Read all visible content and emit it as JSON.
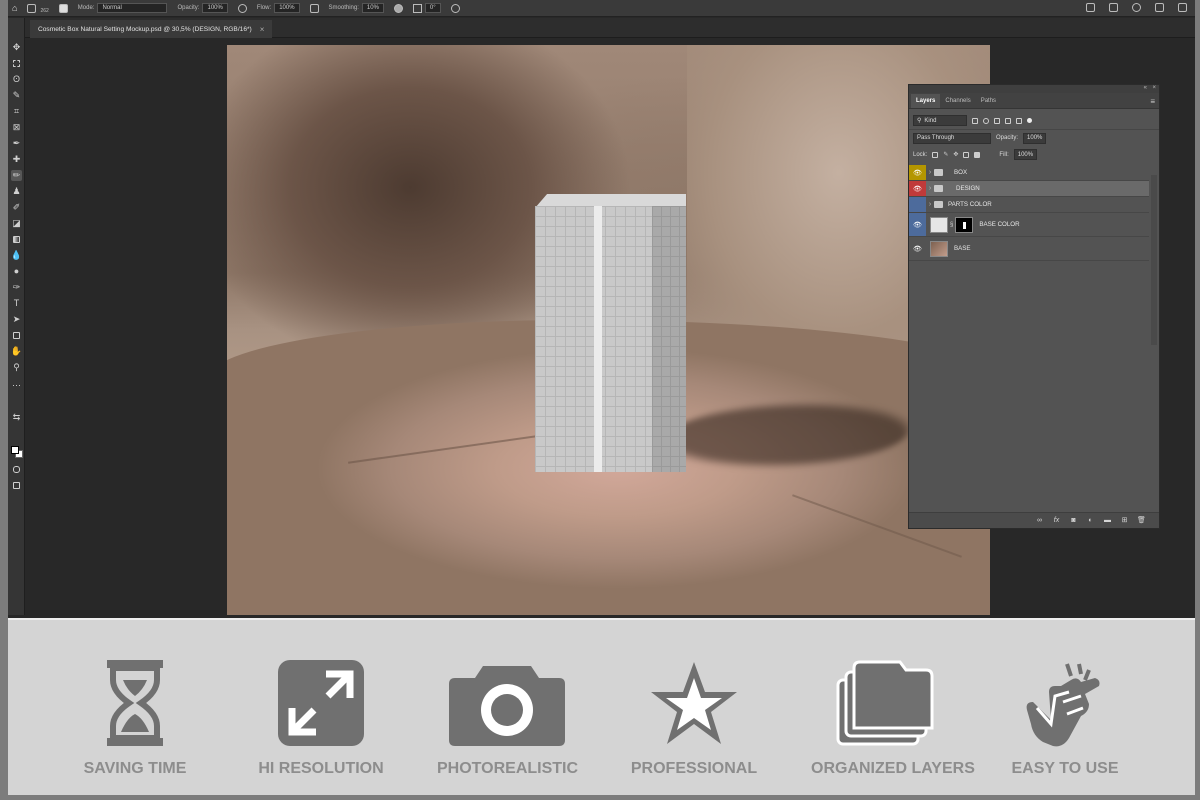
{
  "options_bar": {
    "brush_size": "262",
    "mode_label": "Mode:",
    "mode_value": "Normal",
    "opacity_label": "Opacity:",
    "opacity_value": "100%",
    "flow_label": "Flow:",
    "flow_value": "100%",
    "smoothing_label": "Smoothing:",
    "smoothing_value": "10%",
    "angle_value": "0°"
  },
  "document_tab": {
    "title": "Cosmetic Box Natural Setting Mockup.psd @ 30,5% (DESIGN, RGB/16*)",
    "close": "×"
  },
  "layers_panel": {
    "tabs": [
      "Layers",
      "Channels",
      "Paths"
    ],
    "filter_kind": "Kind",
    "blend_mode": "Pass Through",
    "opacity_label": "Opacity:",
    "opacity_value": "100%",
    "lock_label": "Lock:",
    "fill_label": "Fill:",
    "fill_value": "100%",
    "layers": [
      {
        "name": "BOX",
        "type": "group",
        "eye_color": "#b49600"
      },
      {
        "name": "DESIGN",
        "type": "group",
        "eye_color": "#c03a3a",
        "selected": true
      },
      {
        "name": "PARTS COLOR",
        "type": "group",
        "eye_color": "#4d6b9c",
        "visible": false
      },
      {
        "name": "BASE COLOR",
        "type": "fill",
        "eye_color": "#4d6b9c"
      },
      {
        "name": "BASE",
        "type": "image"
      }
    ]
  },
  "features": [
    {
      "icon": "hourglass-icon",
      "label": "SAVING TIME"
    },
    {
      "icon": "expand-icon",
      "label": "HI RESOLUTION"
    },
    {
      "icon": "camera-icon",
      "label": "PHOTOREALISTIC"
    },
    {
      "icon": "star-icon",
      "label": "PROFESSIONAL"
    },
    {
      "icon": "folders-icon",
      "label": "ORGANIZED LAYERS"
    },
    {
      "icon": "pointer-hand-icon",
      "label": "EASY TO USE"
    }
  ],
  "colors": {
    "feature_icon": "#707070",
    "feature_label": "#8d8d8d",
    "feature_bg": "#d4d4d4",
    "panel_bg": "#535353",
    "canvas_bg": "#282828"
  }
}
